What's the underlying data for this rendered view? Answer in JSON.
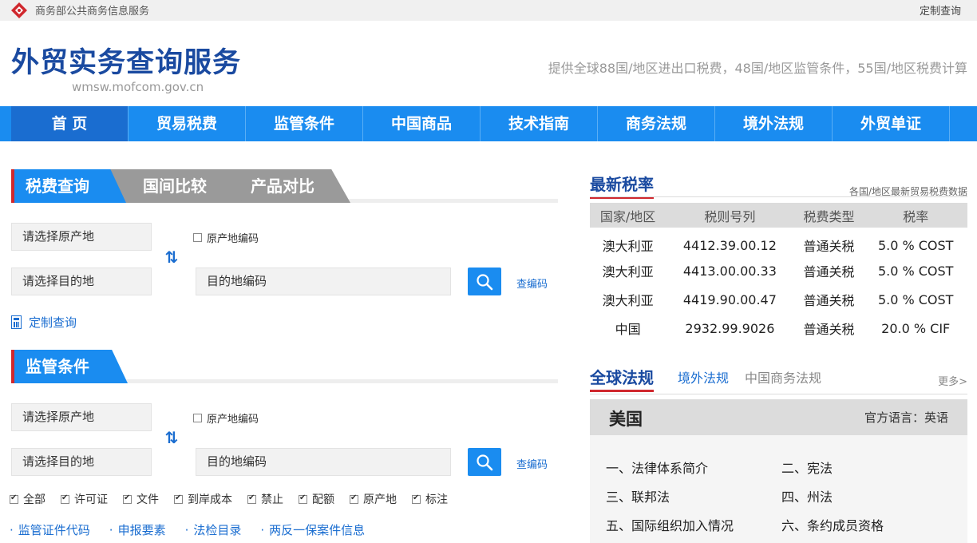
{
  "topbar": {
    "site_name": "商务部公共商务信息服务",
    "custom_query": "定制查询"
  },
  "header": {
    "title": "外贸实务查询服务",
    "domain": "wmsw.mofcom.gov.cn",
    "slogan": "提供全球88国/地区进出口税费，48国/地区监管条件，55国/地区税费计算"
  },
  "nav": {
    "items": [
      "首 页",
      "贸易税费",
      "监管条件",
      "中国商品",
      "技术指南",
      "商务法规",
      "境外法规",
      "外贸单证"
    ]
  },
  "tax_section": {
    "tabs": [
      "税费查询",
      "国间比较",
      "产品对比"
    ],
    "origin_placeholder": "请选择原产地",
    "origin_code_label": "原产地编码",
    "dest_placeholder": "请选择目的地",
    "dest_code_placeholder": "目的地编码",
    "code_link": "查编码",
    "custom_query": "定制查询"
  },
  "supervision_section": {
    "title": "监管条件",
    "origin_placeholder": "请选择原产地",
    "origin_code_label": "原产地编码",
    "dest_placeholder": "请选择目的地",
    "dest_code_placeholder": "目的地编码",
    "code_link": "查编码",
    "filters": [
      "全部",
      "许可证",
      "文件",
      "到岸成本",
      "禁止",
      "配额",
      "原产地",
      "标注"
    ],
    "links": [
      "监管证件代码",
      "申报要素",
      "法检目录",
      "两反一保案件信息"
    ]
  },
  "latest_rates": {
    "title": "最新税率",
    "note": "各国/地区最新贸易税费数据",
    "headers": [
      "国家/地区",
      "税则号列",
      "税费类型",
      "税率"
    ],
    "rows": [
      [
        "澳大利亚",
        "4412.39.00.12",
        "普通关税",
        "5.0 % COST"
      ],
      [
        "澳大利亚",
        "4413.00.00.33",
        "普通关税",
        "5.0 % COST"
      ],
      [
        "澳大利亚",
        "4419.90.00.47",
        "普通关税",
        "5.0 % COST"
      ],
      [
        "中国",
        "2932.99.9026",
        "普通关税",
        "20.0 % CIF"
      ]
    ]
  },
  "global_laws": {
    "title": "全球法规",
    "tabs": [
      "境外法规",
      "中国商务法规"
    ],
    "more": "更多>",
    "country": "美国",
    "language": "官方语言：英语",
    "items": [
      "一、法律体系简介",
      "二、宪法",
      "三、联邦法",
      "四、州法",
      "五、国际组织加入情况",
      "六、条约成员资格"
    ]
  },
  "colors": {
    "brand_blue": "#1a8cf0",
    "nav_active": "#1a6dd0",
    "title_blue": "#1a4aa0",
    "accent_red": "#d0282e"
  }
}
